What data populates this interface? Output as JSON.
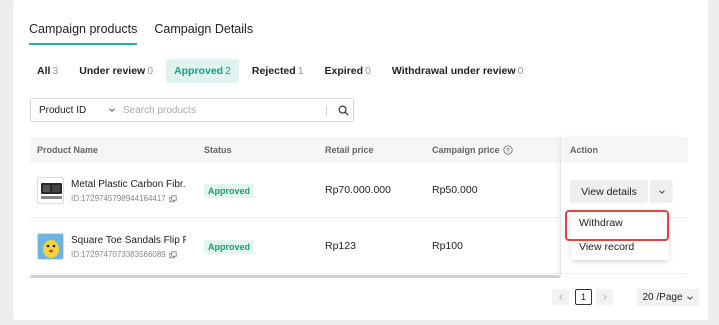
{
  "tabs": [
    {
      "label": "Campaign products",
      "active": true
    },
    {
      "label": "Campaign Details",
      "active": false
    }
  ],
  "filters": [
    {
      "label": "All",
      "count": "3",
      "active": false
    },
    {
      "label": "Under review",
      "count": "0",
      "active": false
    },
    {
      "label": "Approved",
      "count": "2",
      "active": true
    },
    {
      "label": "Rejected",
      "count": "1",
      "active": false
    },
    {
      "label": "Expired",
      "count": "0",
      "active": false
    },
    {
      "label": "Withdrawal under review",
      "count": "0",
      "active": false
    }
  ],
  "search": {
    "field_select": "Product ID",
    "placeholder": "Search products"
  },
  "table": {
    "columns": {
      "product_name": "Product Name",
      "status": "Status",
      "retail_price": "Retail price",
      "campaign_price": "Campaign price",
      "action": "Action"
    },
    "rows": [
      {
        "name": "Metal Plastic Carbon Fibr...",
        "id": "ID:1729745798944164417",
        "status": "Approved",
        "retail_price": "Rp70.000.000",
        "campaign_price": "Rp50.000",
        "action_label": "View details"
      },
      {
        "name": "Square Toe Sandals Flip F...",
        "id": "ID:1729747073383566089",
        "status": "Approved",
        "retail_price": "Rp123",
        "campaign_price": "Rp100"
      }
    ]
  },
  "dropdown": {
    "items": [
      "Withdraw",
      "View record"
    ]
  },
  "pagination": {
    "current_page": "1",
    "per_page": "20 /Page"
  },
  "colors": {
    "accent": "#20b2aa",
    "approved_bg": "#e3f6ee",
    "approved_text": "#1f9d6e",
    "highlight": "#e0453f"
  }
}
